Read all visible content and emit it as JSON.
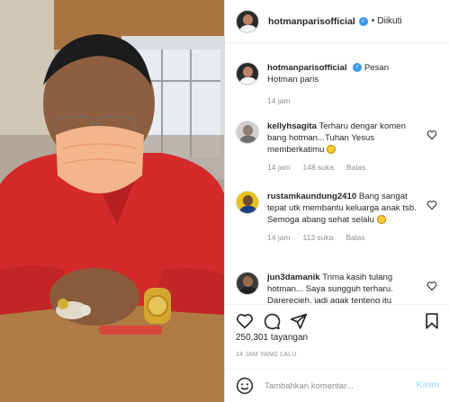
{
  "post": {
    "author": "hotmanparisofficial",
    "separator": "•",
    "follow_status": "Diikuti"
  },
  "caption": {
    "username": "hotmanparisofficial",
    "text": "Pesan Hotman paris",
    "time": "14 jam"
  },
  "comments": [
    {
      "username": "kellyhsagita",
      "text": "Terharu dengar komen bang hotman...Tuhan Yesus memberkatimu",
      "emoji": "smiling-face",
      "time": "14 jam",
      "likes": "148 suka",
      "reply": "Balas"
    },
    {
      "username": "rustamkaundung2410",
      "text": "Bang sangat tepat utk membantu keluarga anak tsb. Semoga abang sehat selalu",
      "emoji": "thumbs-up",
      "time": "14 jam",
      "likes": "113 suka",
      "reply": "Balas"
    },
    {
      "username": "jun3damanik",
      "text": "Trima kasih tulang hotman... Saya sungguh terharu. Darerecieh, jadi agak tenteng itu",
      "time": "",
      "likes": "",
      "reply": ""
    }
  ],
  "stats": {
    "views": "250,301 tayangan",
    "time_ago": "14 JAM YANG LALU"
  },
  "compose": {
    "placeholder": "Tambahkan komentar...",
    "post_label": "Kirim"
  },
  "icons": {
    "like": "heart-icon",
    "comment": "comment-icon",
    "share": "share-icon",
    "save": "bookmark-icon",
    "emoji": "smiley-icon"
  },
  "colors": {
    "verified": "#3897f0",
    "post_button_disabled": "#b2dffc",
    "muted_text": "#8e8e8e",
    "shirt": "#d42a2a"
  }
}
